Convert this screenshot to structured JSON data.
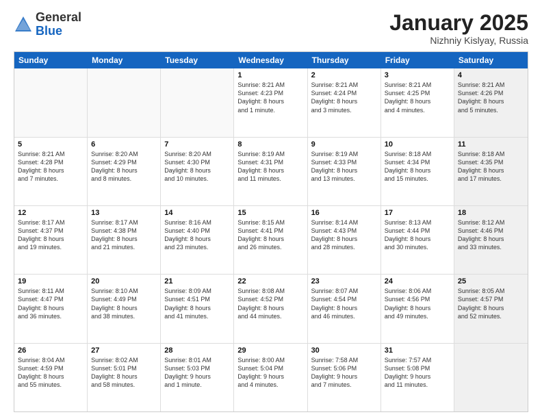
{
  "header": {
    "logo_general": "General",
    "logo_blue": "Blue",
    "month_title": "January 2025",
    "location": "Nizhniy Kislyay, Russia"
  },
  "weekdays": [
    "Sunday",
    "Monday",
    "Tuesday",
    "Wednesday",
    "Thursday",
    "Friday",
    "Saturday"
  ],
  "rows": [
    [
      {
        "day": "",
        "text": "",
        "empty": true
      },
      {
        "day": "",
        "text": "",
        "empty": true
      },
      {
        "day": "",
        "text": "",
        "empty": true
      },
      {
        "day": "1",
        "text": "Sunrise: 8:21 AM\nSunset: 4:23 PM\nDaylight: 8 hours\nand 1 minute."
      },
      {
        "day": "2",
        "text": "Sunrise: 8:21 AM\nSunset: 4:24 PM\nDaylight: 8 hours\nand 3 minutes."
      },
      {
        "day": "3",
        "text": "Sunrise: 8:21 AM\nSunset: 4:25 PM\nDaylight: 8 hours\nand 4 minutes."
      },
      {
        "day": "4",
        "text": "Sunrise: 8:21 AM\nSunset: 4:26 PM\nDaylight: 8 hours\nand 5 minutes.",
        "shaded": true
      }
    ],
    [
      {
        "day": "5",
        "text": "Sunrise: 8:21 AM\nSunset: 4:28 PM\nDaylight: 8 hours\nand 7 minutes."
      },
      {
        "day": "6",
        "text": "Sunrise: 8:20 AM\nSunset: 4:29 PM\nDaylight: 8 hours\nand 8 minutes."
      },
      {
        "day": "7",
        "text": "Sunrise: 8:20 AM\nSunset: 4:30 PM\nDaylight: 8 hours\nand 10 minutes."
      },
      {
        "day": "8",
        "text": "Sunrise: 8:19 AM\nSunset: 4:31 PM\nDaylight: 8 hours\nand 11 minutes."
      },
      {
        "day": "9",
        "text": "Sunrise: 8:19 AM\nSunset: 4:33 PM\nDaylight: 8 hours\nand 13 minutes."
      },
      {
        "day": "10",
        "text": "Sunrise: 8:18 AM\nSunset: 4:34 PM\nDaylight: 8 hours\nand 15 minutes."
      },
      {
        "day": "11",
        "text": "Sunrise: 8:18 AM\nSunset: 4:35 PM\nDaylight: 8 hours\nand 17 minutes.",
        "shaded": true
      }
    ],
    [
      {
        "day": "12",
        "text": "Sunrise: 8:17 AM\nSunset: 4:37 PM\nDaylight: 8 hours\nand 19 minutes."
      },
      {
        "day": "13",
        "text": "Sunrise: 8:17 AM\nSunset: 4:38 PM\nDaylight: 8 hours\nand 21 minutes."
      },
      {
        "day": "14",
        "text": "Sunrise: 8:16 AM\nSunset: 4:40 PM\nDaylight: 8 hours\nand 23 minutes."
      },
      {
        "day": "15",
        "text": "Sunrise: 8:15 AM\nSunset: 4:41 PM\nDaylight: 8 hours\nand 26 minutes."
      },
      {
        "day": "16",
        "text": "Sunrise: 8:14 AM\nSunset: 4:43 PM\nDaylight: 8 hours\nand 28 minutes."
      },
      {
        "day": "17",
        "text": "Sunrise: 8:13 AM\nSunset: 4:44 PM\nDaylight: 8 hours\nand 30 minutes."
      },
      {
        "day": "18",
        "text": "Sunrise: 8:12 AM\nSunset: 4:46 PM\nDaylight: 8 hours\nand 33 minutes.",
        "shaded": true
      }
    ],
    [
      {
        "day": "19",
        "text": "Sunrise: 8:11 AM\nSunset: 4:47 PM\nDaylight: 8 hours\nand 36 minutes."
      },
      {
        "day": "20",
        "text": "Sunrise: 8:10 AM\nSunset: 4:49 PM\nDaylight: 8 hours\nand 38 minutes."
      },
      {
        "day": "21",
        "text": "Sunrise: 8:09 AM\nSunset: 4:51 PM\nDaylight: 8 hours\nand 41 minutes."
      },
      {
        "day": "22",
        "text": "Sunrise: 8:08 AM\nSunset: 4:52 PM\nDaylight: 8 hours\nand 44 minutes."
      },
      {
        "day": "23",
        "text": "Sunrise: 8:07 AM\nSunset: 4:54 PM\nDaylight: 8 hours\nand 46 minutes."
      },
      {
        "day": "24",
        "text": "Sunrise: 8:06 AM\nSunset: 4:56 PM\nDaylight: 8 hours\nand 49 minutes."
      },
      {
        "day": "25",
        "text": "Sunrise: 8:05 AM\nSunset: 4:57 PM\nDaylight: 8 hours\nand 52 minutes.",
        "shaded": true
      }
    ],
    [
      {
        "day": "26",
        "text": "Sunrise: 8:04 AM\nSunset: 4:59 PM\nDaylight: 8 hours\nand 55 minutes."
      },
      {
        "day": "27",
        "text": "Sunrise: 8:02 AM\nSunset: 5:01 PM\nDaylight: 8 hours\nand 58 minutes."
      },
      {
        "day": "28",
        "text": "Sunrise: 8:01 AM\nSunset: 5:03 PM\nDaylight: 9 hours\nand 1 minute."
      },
      {
        "day": "29",
        "text": "Sunrise: 8:00 AM\nSunset: 5:04 PM\nDaylight: 9 hours\nand 4 minutes."
      },
      {
        "day": "30",
        "text": "Sunrise: 7:58 AM\nSunset: 5:06 PM\nDaylight: 9 hours\nand 7 minutes."
      },
      {
        "day": "31",
        "text": "Sunrise: 7:57 AM\nSunset: 5:08 PM\nDaylight: 9 hours\nand 11 minutes."
      },
      {
        "day": "",
        "text": "",
        "empty": true,
        "shaded": true
      }
    ]
  ]
}
